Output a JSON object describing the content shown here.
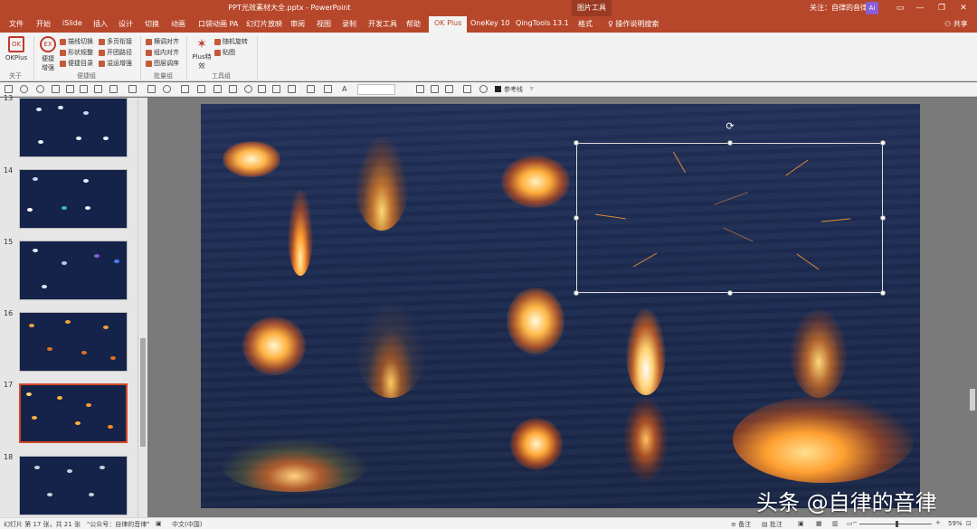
{
  "titlebar": {
    "doc_title": "PPT光效素材大全.pptx  -  PowerPoint",
    "context_tools": "图片工具",
    "notice": "关注：自律的音律",
    "avatar": "Ai",
    "min": "—",
    "restore": "❐",
    "close": "✕"
  },
  "tabs": [
    {
      "label": "文件"
    },
    {
      "label": "开始"
    },
    {
      "label": "iSlide"
    },
    {
      "label": "插入"
    },
    {
      "label": "设计"
    },
    {
      "label": "切换"
    },
    {
      "label": "动画"
    },
    {
      "label": "口袋动画 PA"
    },
    {
      "label": "幻灯片放映"
    },
    {
      "label": "审阅"
    },
    {
      "label": "视图"
    },
    {
      "label": "录制"
    },
    {
      "label": "开发工具"
    },
    {
      "label": "帮助"
    },
    {
      "label": "OK Plus"
    },
    {
      "label": "OneKey 10"
    },
    {
      "label": "QingTools 13.1"
    },
    {
      "label": "格式"
    }
  ],
  "search_label": "操作说明搜索",
  "share_label": "共享",
  "ribbon": {
    "okplus_label": "OKPlus",
    "about_group": "关于",
    "convenient_label": "便捷增强",
    "items_col1": [
      "描线切换",
      "形状规整",
      "便捷目录"
    ],
    "items_col2": [
      "多页衔接",
      "开团路径",
      "溢运增强"
    ],
    "convenient_group": "便捷组",
    "items_col3": [
      "横调对齐",
      "组内对齐",
      "图层调序"
    ],
    "batch_group": "批量组",
    "plus_label": "Plus特效",
    "items_col4": [
      "随机旋转",
      "贴图"
    ],
    "tool_group": "工具组"
  },
  "qat": {
    "ref_line": "参考线"
  },
  "slides": [
    {
      "number": "13"
    },
    {
      "number": "14"
    },
    {
      "number": "15"
    },
    {
      "number": "16"
    },
    {
      "number": "17"
    },
    {
      "number": "18"
    }
  ],
  "watermark": "头条 @自律的音律",
  "status": {
    "slide_info": "幻灯片 第 17 张，共 21 张",
    "tag": "\"公众号：自律的音律\"",
    "language": "中文(中国)",
    "notes": "备注",
    "comments": "批注",
    "zoom": "59%"
  },
  "colors": {
    "accent": "#b7472a",
    "slide_bg": "#1f2d52"
  }
}
